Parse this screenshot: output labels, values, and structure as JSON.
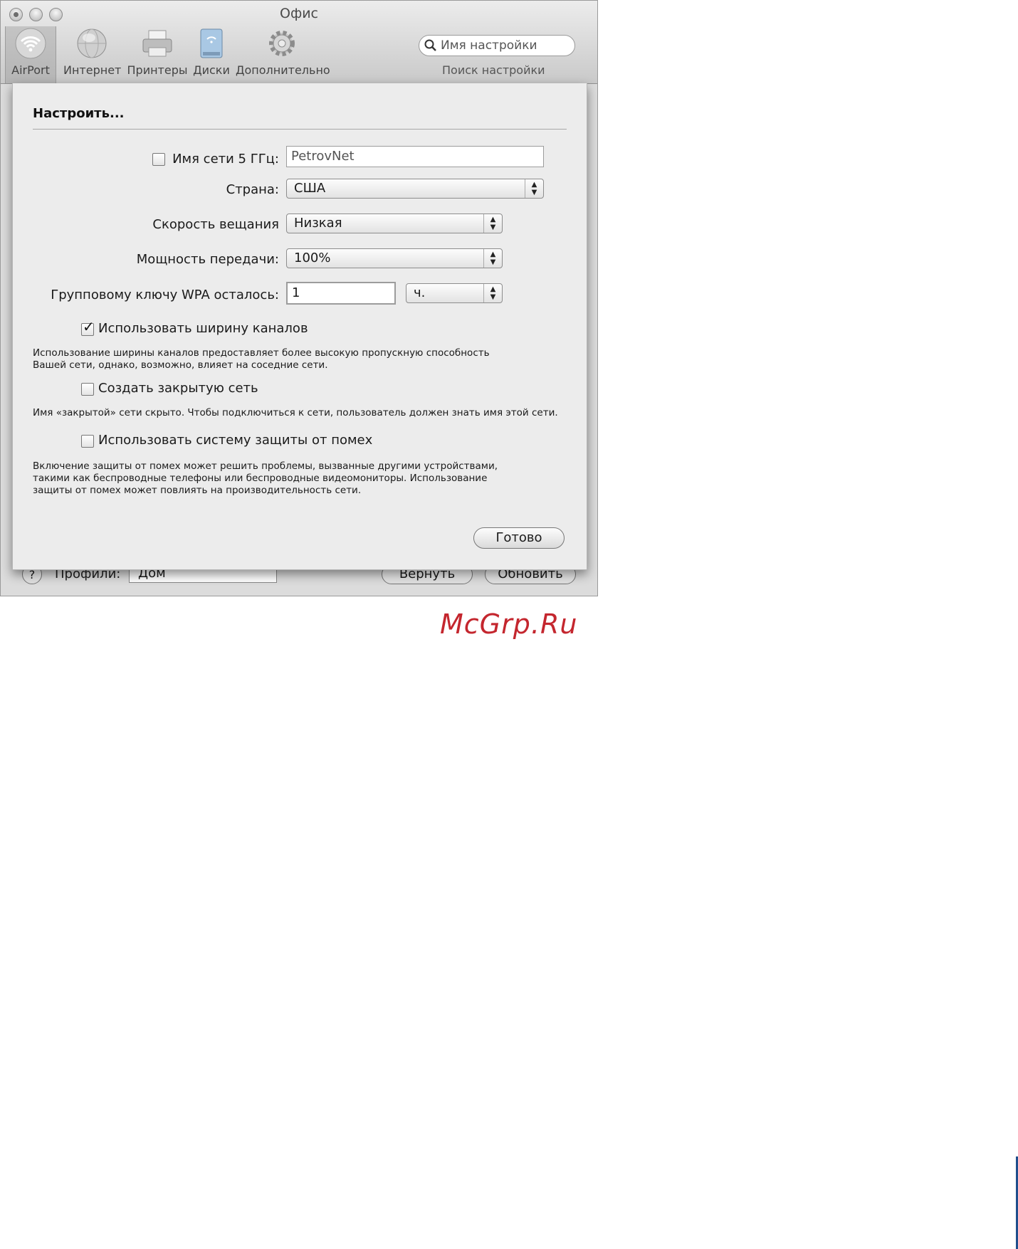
{
  "window": {
    "title": "Офис",
    "toolbar": [
      {
        "label": "AirPort",
        "icon": "airport-wifi-icon",
        "active": true
      },
      {
        "label": "Интернет",
        "icon": "globe-icon"
      },
      {
        "label": "Принтеры",
        "icon": "printer-icon"
      },
      {
        "label": "Диски",
        "icon": "disk-icon"
      },
      {
        "label": "Дополнительно",
        "icon": "gear-icon"
      }
    ],
    "search": {
      "placeholder": "Имя настройки",
      "caption": "Поиск настройки"
    }
  },
  "footer": {
    "profiles_label": "Профили:",
    "profile_value": "Дом",
    "revert_label": "Вернуть",
    "update_label": "Обновить",
    "help_label": "?"
  },
  "sheet": {
    "title": "Настроить...",
    "network_5ghz": {
      "label": "Имя сети 5 ГГц:",
      "value": "PetrovNet",
      "checked": false
    },
    "country": {
      "label": "Страна:",
      "value": "США"
    },
    "multicast_rate": {
      "label": "Скорость вещания",
      "value": "Низкая"
    },
    "transmit_power": {
      "label": "Мощность передачи:",
      "value": "100%"
    },
    "wpa_group_key": {
      "label": "Групповому ключу WPA осталось:",
      "value": "1",
      "unit": "ч."
    },
    "wide_channels": {
      "label": "Использовать ширину каналов",
      "checked": true,
      "help_line1": "Использование ширины каналов предоставляет более высокую пропускную способность",
      "help_line2": "Вашей сети, однако, возможно, влияет на соседние сети."
    },
    "closed_network": {
      "label": "Создать закрытую сеть",
      "checked": false,
      "help": "Имя «закрытой» сети скрыто. Чтобы подключиться к сети, пользователь должен знать имя этой сети."
    },
    "interference": {
      "label": "Использовать систему защиты от помех",
      "checked": false,
      "help_line1": "Включение защиты от помех может решить проблемы, вызванные другими устройствами,",
      "help_line2": "такими как беспроводные телефоны или беспроводные видеомониторы. Использование",
      "help_line3": "защиты от помех может повлиять на производительность сети."
    },
    "done_label": "Готово"
  },
  "watermark": "McGrp.Ru",
  "colors": {
    "watermark": "#c4262e",
    "edge_bar": "#1f4e8c"
  }
}
